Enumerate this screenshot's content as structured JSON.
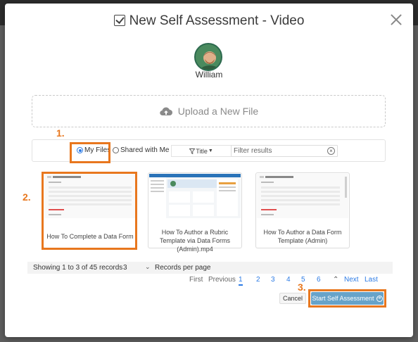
{
  "modal": {
    "title": "New Self Assessment - Video",
    "user_name": "William"
  },
  "upload": {
    "label": "Upload a New File"
  },
  "filter": {
    "my_files_label": "My Files",
    "shared_label": "Shared with Me",
    "sort_label": "Title",
    "search_placeholder": "Filter results",
    "selected_source": "My Files"
  },
  "callouts": {
    "step1": "1.",
    "step2": "2.",
    "step3": "3."
  },
  "files": [
    {
      "label": "How To Complete a Data Form",
      "selected": true
    },
    {
      "label": "How To Author a Rubric Template via Data Forms (Admin).mp4",
      "selected": false
    },
    {
      "label": "How To Author a Data Form Template (Admin)",
      "selected": false
    }
  ],
  "pagination": {
    "summary": "Showing 1 to 3 of 45 records",
    "per_page_value": "3",
    "per_page_label": "Records per page",
    "first": "First",
    "previous": "Previous",
    "pages": [
      "1",
      "2",
      "3",
      "4",
      "5",
      "6"
    ],
    "current_page": "1",
    "next": "Next",
    "last": "Last"
  },
  "actions": {
    "cancel": "Cancel",
    "start": "Start Self Assessment"
  },
  "colors": {
    "highlight": "#e8771e",
    "accent": "#2c7be5",
    "start_button": "#67a3c9"
  },
  "icons": [
    "checkbox-icon",
    "close-icon",
    "cloud-upload-icon",
    "filter-icon",
    "caret-down-icon",
    "clear-icon",
    "chevron-down-icon",
    "chevron-up-icon",
    "arrow-right-circle-icon"
  ]
}
